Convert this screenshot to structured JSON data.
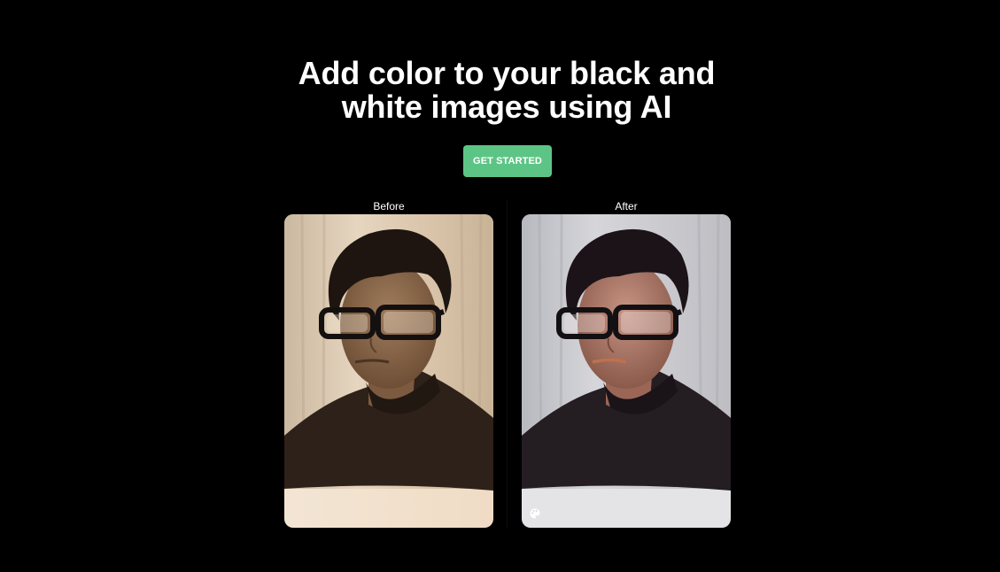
{
  "hero": {
    "title_line1": "Add color to your black and",
    "title_line2": "white images using AI",
    "cta_label": "GET STARTED"
  },
  "comparison": {
    "before_label": "Before",
    "after_label": "After",
    "before_photo": "sepia-portrait-man-glasses",
    "after_photo": "colorized-portrait-man-glasses",
    "watermark_icon": "palette-icon"
  },
  "colors": {
    "background": "#000000",
    "cta": "#5cc585",
    "text": "#ffffff"
  }
}
